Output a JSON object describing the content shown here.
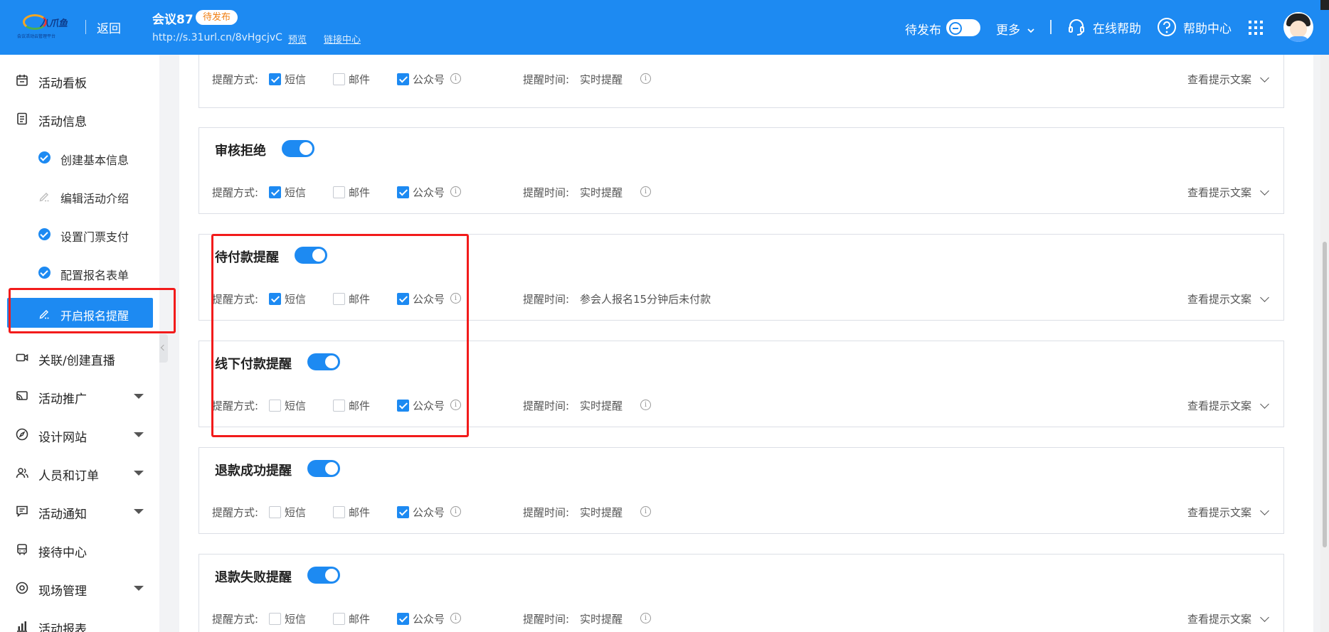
{
  "header": {
    "logo_text": "八爪鱼",
    "logo_sub": "会议活动云管理平台",
    "back_label": "返回",
    "title": "会议87",
    "status_badge": "待发布",
    "url": "http://s.31url.cn/8vHgcjvC",
    "preview_link": "预览",
    "link_center": "链接中心",
    "publish_status": "待发布",
    "more_label": "更多",
    "online_help": "在线帮助",
    "help_center": "帮助中心"
  },
  "sidebar": {
    "items": [
      {
        "label": "活动看板",
        "icon": "calendar-icon"
      },
      {
        "label": "活动信息",
        "icon": "document-icon"
      },
      {
        "label": "关联/创建直播",
        "icon": "video-icon"
      },
      {
        "label": "活动推广",
        "icon": "cast-icon"
      },
      {
        "label": "设计网站",
        "icon": "compass-icon"
      },
      {
        "label": "人员和订单",
        "icon": "people-icon"
      },
      {
        "label": "活动通知",
        "icon": "message-icon"
      },
      {
        "label": "接待中心",
        "icon": "bus-icon"
      },
      {
        "label": "现场管理",
        "icon": "target-icon"
      },
      {
        "label": "活动报表",
        "icon": "bar-chart-icon"
      }
    ],
    "sub_items": [
      {
        "label": "创建基本信息",
        "done": true
      },
      {
        "label": "编辑活动介绍",
        "done": false
      },
      {
        "label": "设置门票支付",
        "done": true
      },
      {
        "label": "配置报名表单",
        "done": true
      },
      {
        "label": "开启报名提醒",
        "active": true
      }
    ]
  },
  "labels": {
    "method": "提醒方式:",
    "sms": "短信",
    "email": "邮件",
    "wechat": "公众号",
    "time_prefix": "提醒时间:",
    "view_copy": "查看提示文案"
  },
  "cards": [
    {
      "title": "",
      "enabled": true,
      "sms": true,
      "email": false,
      "wechat": true,
      "time": "实时提醒"
    },
    {
      "title": "审核拒绝",
      "enabled": true,
      "sms": true,
      "email": false,
      "wechat": true,
      "time": "实时提醒"
    },
    {
      "title": "待付款提醒",
      "enabled": true,
      "sms": true,
      "email": false,
      "wechat": true,
      "time": "参会人报名15分钟后未付款"
    },
    {
      "title": "线下付款提醒",
      "enabled": true,
      "sms": false,
      "email": false,
      "wechat": true,
      "time": "实时提醒"
    },
    {
      "title": "退款成功提醒",
      "enabled": true,
      "sms": false,
      "email": false,
      "wechat": true,
      "time": "实时提醒"
    },
    {
      "title": "退款失败提醒",
      "enabled": true,
      "sms": false,
      "email": false,
      "wechat": true,
      "time": "实时提醒"
    }
  ],
  "colors": {
    "primary": "#1d8af2",
    "badge_text": "#f07f13",
    "highlight": "#f21b1b"
  }
}
